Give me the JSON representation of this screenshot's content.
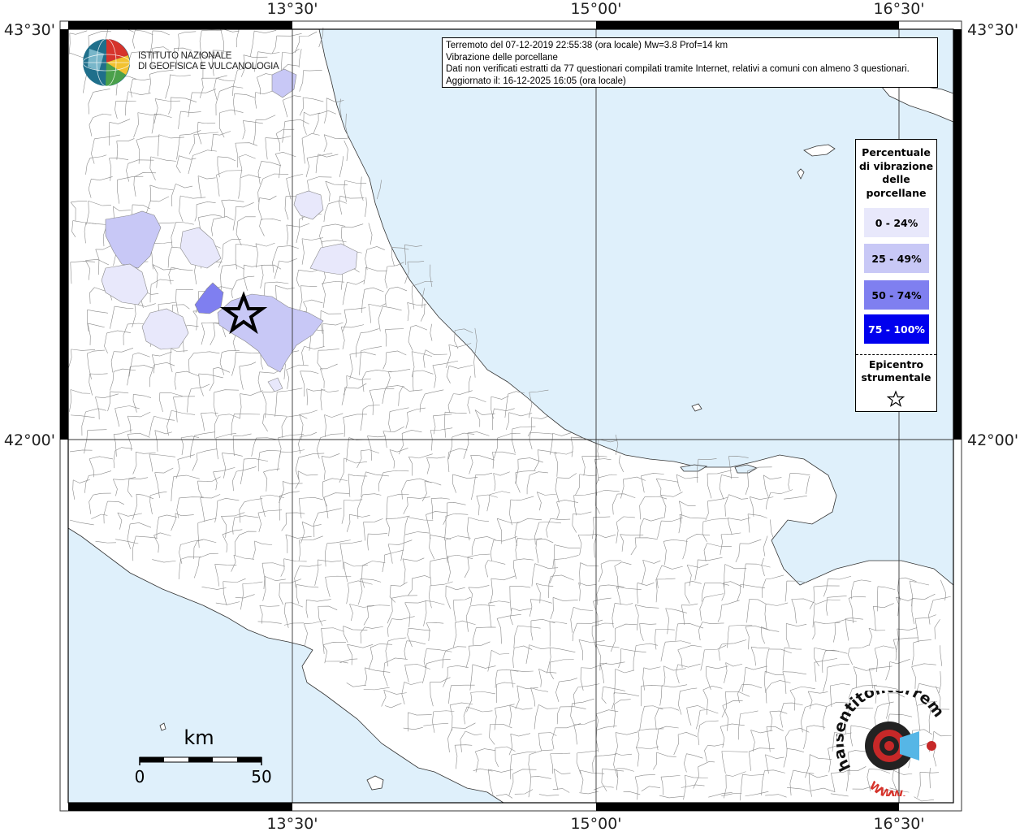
{
  "info": {
    "line1": "Terremoto del 07-12-2019 22:55:38 (ora locale) Mw=3.8 Prof=14 km",
    "line2": "Vibrazione delle porcellane",
    "line3": "Dati non verificati estratti da 77 questionari compilati tramite Internet, relativi a comuni con almeno 3 questionari.",
    "line4": "Aggiornato il: 16-12-2025 16:05 (ora locale)"
  },
  "logo": {
    "line1": "ISTITUTO NAZIONALE",
    "line2": "DI GEOFISICA E VULCANOLOGIA"
  },
  "axes": {
    "top": [
      "13°30'",
      "15°00'",
      "16°30'"
    ],
    "bottom": [
      "13°30'",
      "15°00'",
      "16°30'"
    ],
    "left": [
      "43°30'",
      "42°00'"
    ],
    "right": [
      "43°30'",
      "42°00'"
    ]
  },
  "legend": {
    "title_lines": [
      "Percentuale",
      "di vibrazione",
      "delle",
      "porcellane"
    ],
    "classes": [
      {
        "label": "0 - 24%",
        "color": "#e8e8fb"
      },
      {
        "label": "25 - 49%",
        "color": "#c8c8f6"
      },
      {
        "label": "50 - 74%",
        "color": "#7f7ff0"
      },
      {
        "label": "75 - 100%",
        "color": "#0000ee"
      }
    ],
    "epicenter_lines": [
      "Epicentro",
      "strumentale"
    ]
  },
  "scale": {
    "unit": "km",
    "start": "0",
    "end": "50"
  },
  "watermark": {
    "text": "haisentitoilterremoto.it",
    "url": "WWW."
  },
  "colors": {
    "sea": "#dff0fb",
    "land": "#ffffff",
    "border": "#7a7a7a"
  }
}
